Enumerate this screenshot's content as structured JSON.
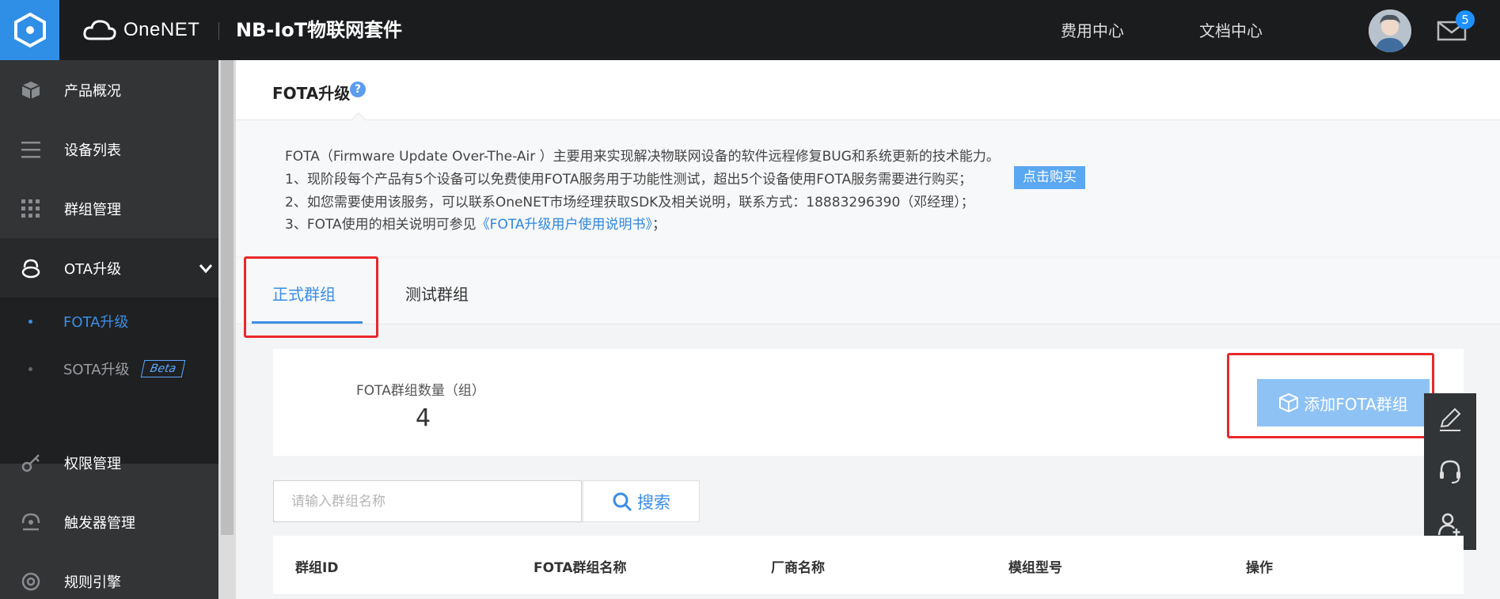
{
  "header": {
    "brand_name": "OneNET",
    "suite_title": "NB-IoT物联网套件",
    "nav": [
      {
        "label": "费用中心"
      },
      {
        "label": "文档中心"
      }
    ],
    "mail_count": "5"
  },
  "sidebar": {
    "items": [
      {
        "label": "产品概况",
        "icon": "cube-icon"
      },
      {
        "label": "设备列表",
        "icon": "list-icon"
      },
      {
        "label": "群组管理",
        "icon": "grid-icon"
      },
      {
        "label": "OTA升级",
        "icon": "ota-icon"
      },
      {
        "label": "权限管理",
        "icon": "key-icon"
      },
      {
        "label": "触发器管理",
        "icon": "trigger-icon"
      },
      {
        "label": "规则引擎",
        "icon": "rule-icon"
      }
    ],
    "sub_items": [
      {
        "label": "FOTA升级"
      },
      {
        "label": "SOTA升级",
        "badge": "Beta"
      }
    ]
  },
  "page": {
    "title": "FOTA升级",
    "help": "?",
    "desc": {
      "line0": "FOTA（Firmware Update Over-The-Air ）主要用来实现解决物联网设备的软件远程修复BUG和系统更新的技术能力。",
      "line1": "1、现阶段每个产品有5个设备可以免费使用FOTA服务用于功能性测试，超出5个设备使用FOTA服务需要进行购买；",
      "buy_label": "点击购买",
      "line2": "2、如您需要使用该服务，可以联系OneNET市场经理获取SDK及相关说明，联系方式：18883296390（邓经理）；",
      "line3_prefix": "3、FOTA使用的相关说明可参见",
      "line3_link": "《FOTA升级用户使用说明书》",
      "line3_suffix": "；"
    },
    "tabs": [
      {
        "label": "正式群组"
      },
      {
        "label": "测试群组"
      }
    ],
    "stat": {
      "label": "FOTA群组数量（组）",
      "value": "4"
    },
    "add_button": "添加FOTA群组",
    "search": {
      "placeholder": "请输入群组名称",
      "button": "搜索"
    },
    "table": {
      "columns": [
        "群组ID",
        "FOTA群组名称",
        "厂商名称",
        "模组型号",
        "操作"
      ]
    }
  },
  "colors": {
    "accent": "#3a8ee6",
    "highlight": "#e8282b",
    "header_bg": "#1b1c1e",
    "sidebar_bg": "#323436"
  }
}
